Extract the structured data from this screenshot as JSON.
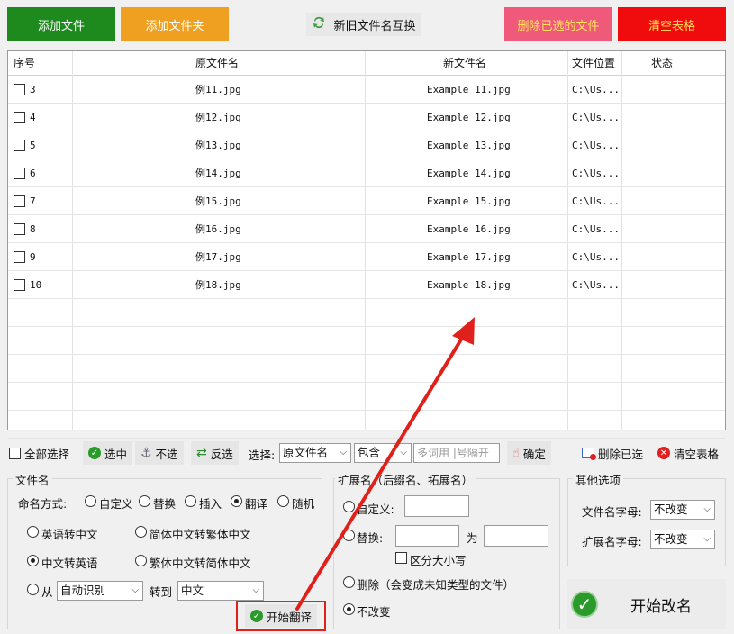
{
  "toolbar": {
    "add_file": "添加文件",
    "add_folder": "添加文件夹",
    "swap_names": "新旧文件名互换",
    "delete_selected": "删除已选的文件",
    "clear_table": "清空表格"
  },
  "table": {
    "headers": {
      "index": "序号",
      "orig": "原文件名",
      "new": "新文件名",
      "loc": "文件位置",
      "status": "状态"
    },
    "rows": [
      {
        "index": "3",
        "orig": "例11.jpg",
        "new": "Example 11.jpg",
        "loc": "C:\\Us...",
        "status": ""
      },
      {
        "index": "4",
        "orig": "例12.jpg",
        "new": "Example 12.jpg",
        "loc": "C:\\Us...",
        "status": ""
      },
      {
        "index": "5",
        "orig": "例13.jpg",
        "new": "Example 13.jpg",
        "loc": "C:\\Us...",
        "status": ""
      },
      {
        "index": "6",
        "orig": "例14.jpg",
        "new": "Example 14.jpg",
        "loc": "C:\\Us...",
        "status": ""
      },
      {
        "index": "7",
        "orig": "例15.jpg",
        "new": "Example 15.jpg",
        "loc": "C:\\Us...",
        "status": ""
      },
      {
        "index": "8",
        "orig": "例16.jpg",
        "new": "Example 16.jpg",
        "loc": "C:\\Us...",
        "status": ""
      },
      {
        "index": "9",
        "orig": "例17.jpg",
        "new": "Example 17.jpg",
        "loc": "C:\\Us...",
        "status": ""
      },
      {
        "index": "10",
        "orig": "例18.jpg",
        "new": "Example 18.jpg",
        "loc": "C:\\Us...",
        "status": ""
      }
    ]
  },
  "selbar": {
    "select_all": "全部选择",
    "select": "选中",
    "unselect": "不选",
    "invert": "反选",
    "select_label": "选择:",
    "field_value": "原文件名",
    "match_value": "包含",
    "keyword_placeholder": "多词用 |号隔开",
    "confirm": "确定",
    "delete_selected": "删除已选",
    "clear_table": "清空表格"
  },
  "filename_group": {
    "title": "文件名",
    "mode_label": "命名方式:",
    "modes": [
      "自定义",
      "替换",
      "插入",
      "翻译",
      "随机"
    ],
    "selected_mode": "翻译",
    "options": {
      "en_to_zh": "英语转中文",
      "sc_to_tc": "简体中文转繁体中文",
      "zh_to_en": "中文转英语",
      "tc_to_sc": "繁体中文转简体中文",
      "from": "从",
      "from_value": "自动识别",
      "to": "转到",
      "to_value": "中文"
    },
    "start_translate": "开始翻译"
  },
  "ext_group": {
    "title": "扩展名（后缀名、拓展名）",
    "custom": "自定义:",
    "replace": "替换:",
    "to": "为",
    "case_sensitive": "区分大小写",
    "delete": "删除（会变成未知类型的文件）",
    "keep": "不改变"
  },
  "other_group": {
    "title": "其他选项",
    "name_case_label": "文件名字母:",
    "name_case_value": "不改变",
    "ext_case_label": "扩展名字母:",
    "ext_case_value": "不改变"
  },
  "start_rename": "开始改名",
  "colors": {
    "green": "#1e8a1e",
    "orange": "#f0a020",
    "pink": "#f05a7a",
    "red": "#f00c0c",
    "highlight": "#e0201a"
  }
}
